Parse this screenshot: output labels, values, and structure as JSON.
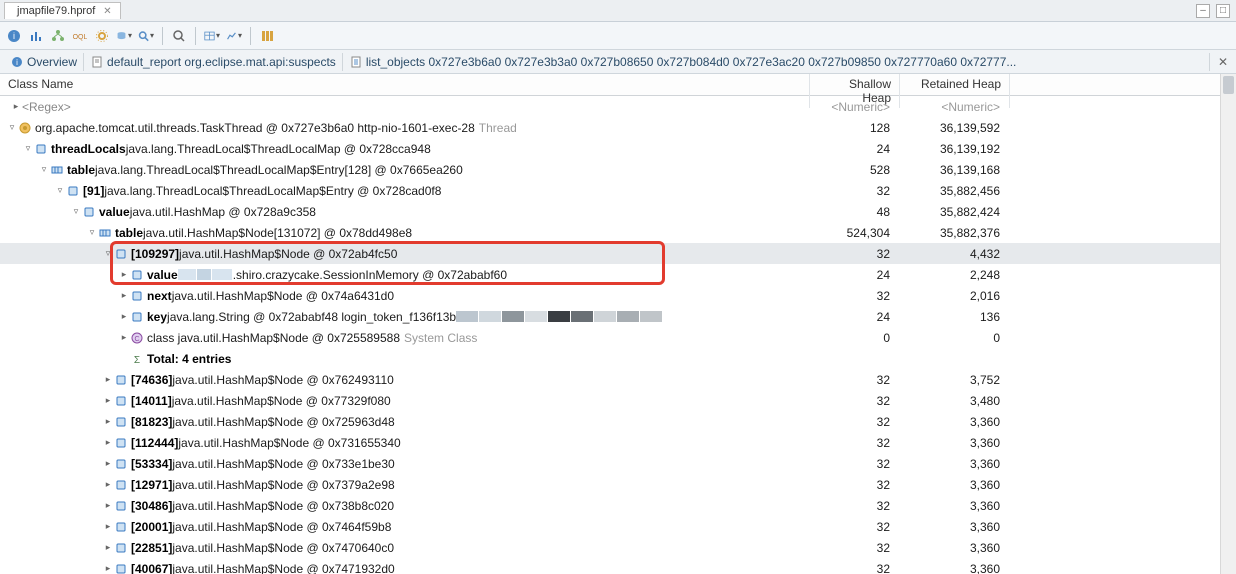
{
  "file_tab": {
    "name": "jmapfile79.hprof",
    "close_glyph": "✕"
  },
  "window": {
    "min": "–",
    "max": "□",
    "restore": "❐"
  },
  "toolbar_icons": [
    "info-icon",
    "bar-chart-icon",
    "tree-icon",
    "sql-icon",
    "gear-icon",
    "db-icon",
    "drop1",
    "magnifier-icon",
    "drop2",
    "sep",
    "search-icon",
    "sep",
    "table-icon",
    "drop3",
    "chart-icon",
    "drop4",
    "sep",
    "bars-icon"
  ],
  "subtabs": {
    "overview": "Overview",
    "report": "default_report org.eclipse.mat.api:suspects",
    "list": "list_objects 0x727e3b6a0 0x727e3b3a0 0x727b08650 0x727b084d0 0x727e3ac20 0x727b09850 0x727770a60 0x72777...",
    "close_glyph": "✕"
  },
  "columns": {
    "name": "Class Name",
    "shallow": "Shallow Heap",
    "retained": "Retained Heap"
  },
  "filter_row": {
    "regex": "<Regex>",
    "num": "<Numeric>"
  },
  "rows": [
    {
      "indent": 0,
      "twisty": "v",
      "icon": "thread",
      "bold": "",
      "text": "org.apache.tomcat.util.threads.TaskThread @ 0x727e3b6a0  http-nio-1601-exec-28",
      "grey": "Thread",
      "shallow": "128",
      "retained": "36,139,592"
    },
    {
      "indent": 1,
      "twisty": "v",
      "icon": "obj",
      "bold": "threadLocals",
      "text": " java.lang.ThreadLocal$ThreadLocalMap @ 0x728cca948",
      "grey": "",
      "shallow": "24",
      "retained": "36,139,192"
    },
    {
      "indent": 2,
      "twisty": "v",
      "icon": "arr",
      "bold": "table",
      "text": " java.lang.ThreadLocal$ThreadLocalMap$Entry[128] @ 0x7665ea260",
      "grey": "",
      "shallow": "528",
      "retained": "36,139,168"
    },
    {
      "indent": 3,
      "twisty": "v",
      "icon": "obj",
      "bold": "[91]",
      "text": " java.lang.ThreadLocal$ThreadLocalMap$Entry @ 0x728cad0f8",
      "grey": "",
      "shallow": "32",
      "retained": "35,882,456"
    },
    {
      "indent": 4,
      "twisty": "v",
      "icon": "obj",
      "bold": "value",
      "text": " java.util.HashMap @ 0x728a9c358",
      "grey": "",
      "shallow": "48",
      "retained": "35,882,424"
    },
    {
      "indent": 5,
      "twisty": "v",
      "icon": "arr",
      "bold": "table",
      "text": " java.util.HashMap$Node[131072] @ 0x78dd498e8",
      "grey": "",
      "shallow": "524,304",
      "retained": "35,882,376"
    },
    {
      "indent": 6,
      "twisty": "v",
      "icon": "obj",
      "bold": "[109297]",
      "text": " java.util.HashMap$Node @ 0x72ab4fc50",
      "grey": "",
      "shallow": "32",
      "retained": "4,432",
      "sel": true
    },
    {
      "indent": 7,
      "twisty": ">",
      "icon": "obj",
      "bold": "value",
      "text_pre": " ",
      "censor": true,
      "text_post": ".shiro.crazycake.SessionInMemory @ 0x72ababf60",
      "grey": "",
      "shallow": "24",
      "retained": "2,248"
    },
    {
      "indent": 7,
      "twisty": ">",
      "icon": "obj",
      "bold": "next",
      "text": " java.util.HashMap$Node @ 0x74a6431d0",
      "grey": "",
      "shallow": "32",
      "retained": "2,016"
    },
    {
      "indent": 7,
      "twisty": ">",
      "icon": "obj",
      "bold": "key",
      "text": " java.lang.String @ 0x72ababf48  login_token_f136f13b",
      "grey": "",
      "censor_tail": true,
      "shallow": "24",
      "retained": "136"
    },
    {
      "indent": 7,
      "twisty": ">",
      "icon": "cls",
      "bold": "<class>",
      "text": " class java.util.HashMap$Node @ 0x725589588",
      "grey": "System Class",
      "shallow": "0",
      "retained": "0"
    },
    {
      "indent": 7,
      "twisty": "",
      "icon": "sum",
      "bold": "",
      "text": "Total: 4 entries",
      "grey": "",
      "shallow": "",
      "retained": "",
      "total": true
    },
    {
      "indent": 6,
      "twisty": ">",
      "icon": "obj",
      "bold": "[74636]",
      "text": " java.util.HashMap$Node @ 0x762493110",
      "grey": "",
      "shallow": "32",
      "retained": "3,752"
    },
    {
      "indent": 6,
      "twisty": ">",
      "icon": "obj",
      "bold": "[14011]",
      "text": " java.util.HashMap$Node @ 0x77329f080",
      "grey": "",
      "shallow": "32",
      "retained": "3,480"
    },
    {
      "indent": 6,
      "twisty": ">",
      "icon": "obj",
      "bold": "[81823]",
      "text": " java.util.HashMap$Node @ 0x725963d48",
      "grey": "",
      "shallow": "32",
      "retained": "3,360"
    },
    {
      "indent": 6,
      "twisty": ">",
      "icon": "obj",
      "bold": "[112444]",
      "text": " java.util.HashMap$Node @ 0x731655340",
      "grey": "",
      "shallow": "32",
      "retained": "3,360"
    },
    {
      "indent": 6,
      "twisty": ">",
      "icon": "obj",
      "bold": "[53334]",
      "text": " java.util.HashMap$Node @ 0x733e1be30",
      "grey": "",
      "shallow": "32",
      "retained": "3,360"
    },
    {
      "indent": 6,
      "twisty": ">",
      "icon": "obj",
      "bold": "[12971]",
      "text": " java.util.HashMap$Node @ 0x7379a2e98",
      "grey": "",
      "shallow": "32",
      "retained": "3,360"
    },
    {
      "indent": 6,
      "twisty": ">",
      "icon": "obj",
      "bold": "[30486]",
      "text": " java.util.HashMap$Node @ 0x738b8c020",
      "grey": "",
      "shallow": "32",
      "retained": "3,360"
    },
    {
      "indent": 6,
      "twisty": ">",
      "icon": "obj",
      "bold": "[20001]",
      "text": " java.util.HashMap$Node @ 0x7464f59b8",
      "grey": "",
      "shallow": "32",
      "retained": "3,360"
    },
    {
      "indent": 6,
      "twisty": ">",
      "icon": "obj",
      "bold": "[22851]",
      "text": " java.util.HashMap$Node @ 0x7470640c0",
      "grey": "",
      "shallow": "32",
      "retained": "3,360"
    },
    {
      "indent": 6,
      "twisty": ">",
      "icon": "obj",
      "bold": "[40067]",
      "text": " java.util.HashMap$Node @ 0x7471932d0",
      "grey": "",
      "shallow": "32",
      "retained": "3,360"
    }
  ],
  "icons": {
    "thread_color": "#e28a2b",
    "obj_color": "#3a79c0",
    "arr_color": "#3a79c0",
    "cls_color": "#8a4aa0",
    "sum_color": "#4a7a4a"
  }
}
